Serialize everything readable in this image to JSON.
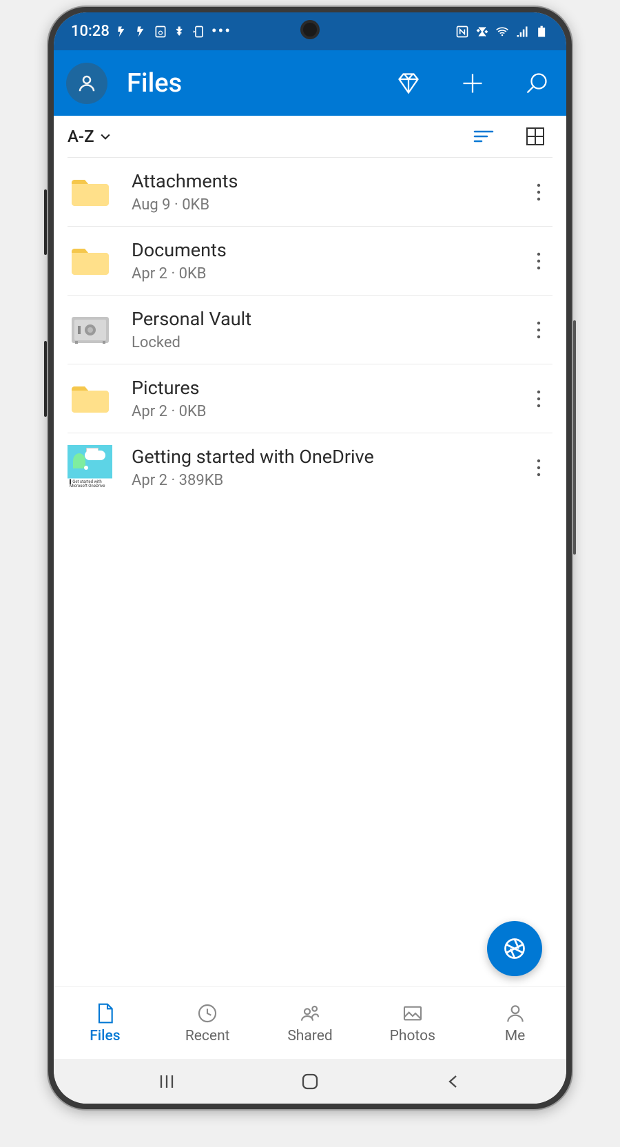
{
  "status": {
    "time": "10:28"
  },
  "header": {
    "title": "Files"
  },
  "sort": {
    "label": "A-Z"
  },
  "files": [
    {
      "name": "Attachments",
      "meta": "Aug 9 · 0KB",
      "type": "folder"
    },
    {
      "name": "Documents",
      "meta": "Apr 2 · 0KB",
      "type": "folder"
    },
    {
      "name": "Personal Vault",
      "meta": "Locked",
      "type": "vault"
    },
    {
      "name": "Pictures",
      "meta": "Apr 2 · 0KB",
      "type": "folder"
    },
    {
      "name": "Getting started with OneDrive",
      "meta": "Apr 2 · 389KB",
      "type": "file"
    }
  ],
  "nav": {
    "files": "Files",
    "recent": "Recent",
    "shared": "Shared",
    "photos": "Photos",
    "me": "Me"
  }
}
